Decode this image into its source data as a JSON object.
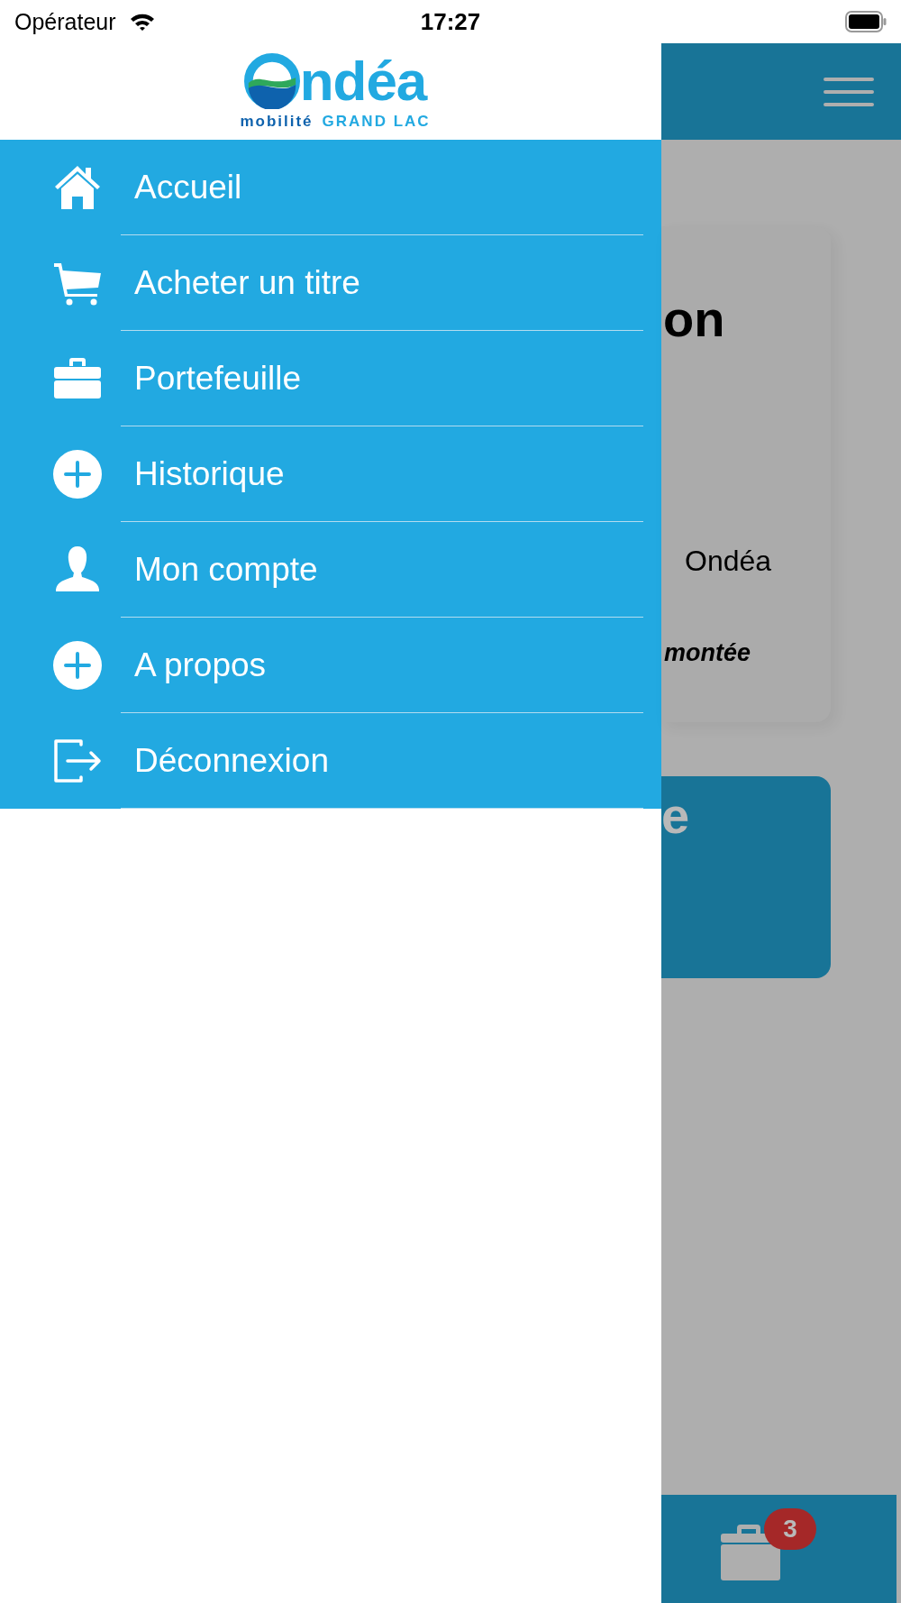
{
  "status_bar": {
    "carrier": "Opérateur",
    "time": "17:27"
  },
  "drawer": {
    "logo": {
      "wordmark": "ndéa",
      "tagline_1": "mobilité",
      "tagline_2": "GRAND LAC"
    },
    "items": [
      {
        "label": "Accueil"
      },
      {
        "label": "Acheter un titre"
      },
      {
        "label": "Portefeuille"
      },
      {
        "label": "Historique"
      },
      {
        "label": "Mon compte"
      },
      {
        "label": "A propos"
      },
      {
        "label": "Déconnexion"
      }
    ]
  },
  "background": {
    "card": {
      "title_fragment": "on",
      "text": "Ondéa",
      "caption_fragment": "montée"
    },
    "action_card": {
      "title_fragment": "e"
    },
    "tab_bar": {
      "badge": "3"
    }
  }
}
